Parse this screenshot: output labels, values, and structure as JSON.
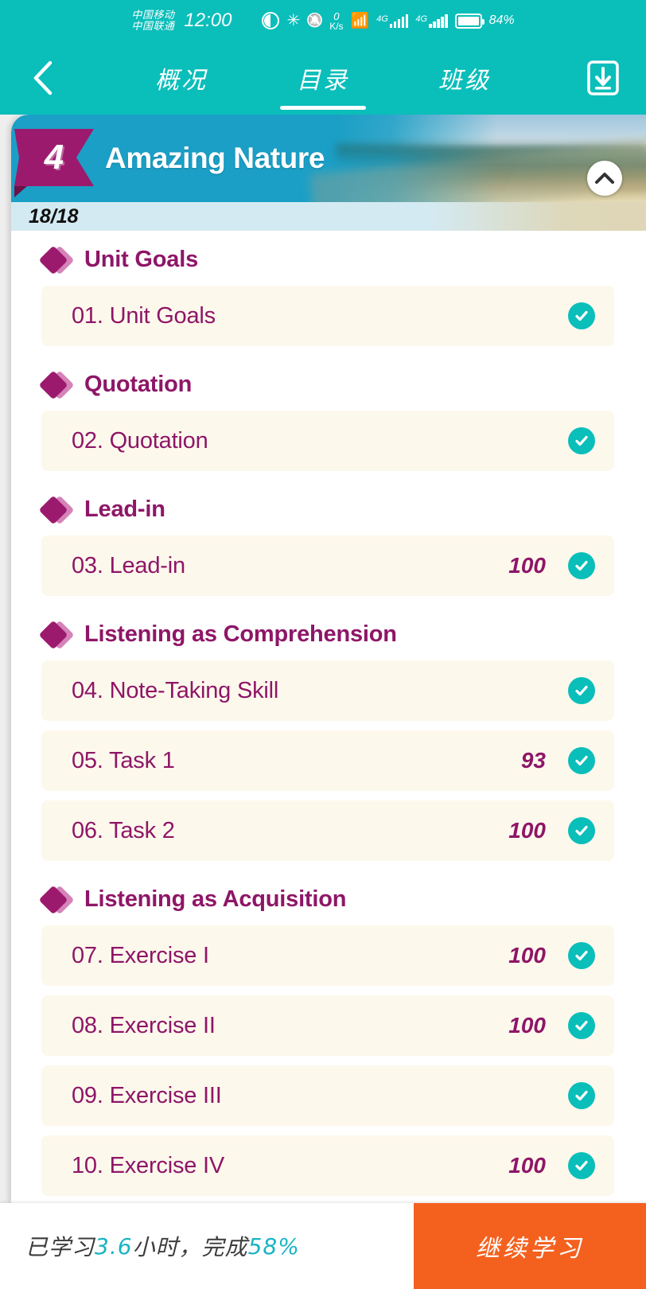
{
  "statusbar": {
    "carrier1": "中国移动",
    "carrier2": "中国联通",
    "time": "12:00",
    "netspeed_value": "0",
    "netspeed_unit": "K/s",
    "net1": "4G",
    "net2": "4G",
    "battery": "84%"
  },
  "nav": {
    "back_icon": "chevron-left-icon",
    "download_icon": "download-icon",
    "tabs": [
      {
        "label": "概况",
        "active": false
      },
      {
        "label": "目录",
        "active": true
      },
      {
        "label": "班级",
        "active": false
      }
    ]
  },
  "unit": {
    "number": "4",
    "title": "Amazing Nature",
    "progress": "18/18",
    "collapse_icon": "chevron-up-icon"
  },
  "sections": [
    {
      "title": "Unit Goals",
      "items": [
        {
          "label": "01. Unit Goals",
          "score": "",
          "completed": true
        }
      ]
    },
    {
      "title": "Quotation",
      "items": [
        {
          "label": "02. Quotation",
          "score": "",
          "completed": true
        }
      ]
    },
    {
      "title": "Lead-in",
      "items": [
        {
          "label": "03. Lead-in",
          "score": "100",
          "completed": true
        }
      ]
    },
    {
      "title": "Listening as Comprehension",
      "items": [
        {
          "label": "04. Note-Taking Skill",
          "score": "",
          "completed": true
        },
        {
          "label": "05. Task 1",
          "score": "93",
          "completed": true
        },
        {
          "label": "06. Task 2",
          "score": "100",
          "completed": true
        }
      ]
    },
    {
      "title": "Listening as Acquisition",
      "items": [
        {
          "label": "07. Exercise I",
          "score": "100",
          "completed": true
        },
        {
          "label": "08. Exercise II",
          "score": "100",
          "completed": true
        },
        {
          "label": "09. Exercise III",
          "score": "",
          "completed": true
        },
        {
          "label": "10. Exercise IV",
          "score": "100",
          "completed": true
        }
      ]
    }
  ],
  "bottom": {
    "prefix": "已学习 ",
    "hours": "3.6",
    "middle": " 小时，完成 ",
    "percent": "58%",
    "button_label": "继续学习"
  },
  "colors": {
    "teal": "#0ABEBA",
    "magenta": "#8E1667",
    "badge": "#9C1A6E",
    "row_bg": "#FDF8EC",
    "hero_blue": "#1B9FC6",
    "orange": "#F4611F",
    "strip": "#D4EAF2"
  }
}
